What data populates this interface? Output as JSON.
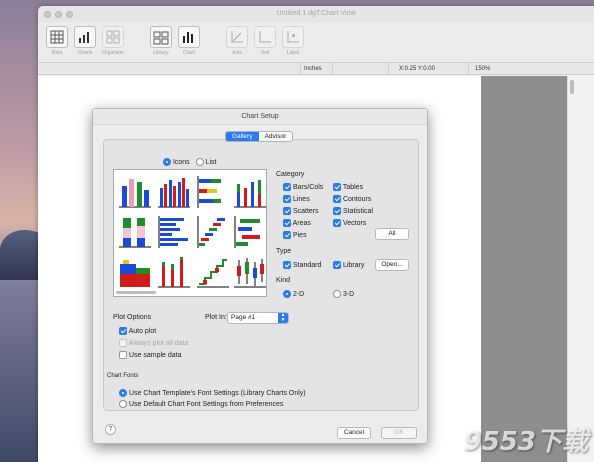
{
  "window": {
    "title": "Untitled 1.dgT:Chart View"
  },
  "toolbar": {
    "items": [
      {
        "label": "Data"
      },
      {
        "label": "Charts"
      },
      {
        "label": "Organizer"
      },
      {
        "label": "Library"
      },
      {
        "label": "Chart"
      },
      {
        "label": "Axis"
      },
      {
        "label": "Text"
      },
      {
        "label": "Label"
      }
    ]
  },
  "statusbar": {
    "units": "Inches",
    "coords": "X:0.25 Y:0.00",
    "zoom": "150%"
  },
  "dialog": {
    "title": "Chart Setup",
    "tabs": [
      {
        "label": "Gallery",
        "selected": true
      },
      {
        "label": "Advisor",
        "selected": false
      }
    ],
    "view_mode": {
      "icons_label": "Icons",
      "list_label": "List",
      "selected": "Icons"
    },
    "category": {
      "heading": "Category",
      "items": [
        "Bars/Cols",
        "Lines",
        "Scatters",
        "Areas",
        "Pies",
        "Tables",
        "Contours",
        "Statistical",
        "Vectors"
      ],
      "all_button": "All"
    },
    "type": {
      "heading": "Type",
      "standard": "Standard",
      "library": "Library",
      "open_button": "Open..."
    },
    "kind": {
      "heading": "Kind",
      "two_d": "2-D",
      "three_d": "3-D",
      "selected": "2-D"
    },
    "plot_options": {
      "heading": "Plot Options",
      "auto_plot": "Auto plot",
      "always_plot_all": "Always plot all data",
      "use_sample": "Use sample data",
      "plot_in_label": "Plot In:",
      "plot_in_value": "Page #1"
    },
    "chart_fonts": {
      "heading": "Chart Fonts",
      "option1": "Use Chart Template's Font Settings (Library Charts Only)",
      "option2": "Use Default Chart Font Settings from Preferences",
      "selected": "option1"
    },
    "buttons": {
      "cancel": "Cancel",
      "ok": "OK",
      "help": "?"
    }
  },
  "watermark": "9553下载"
}
